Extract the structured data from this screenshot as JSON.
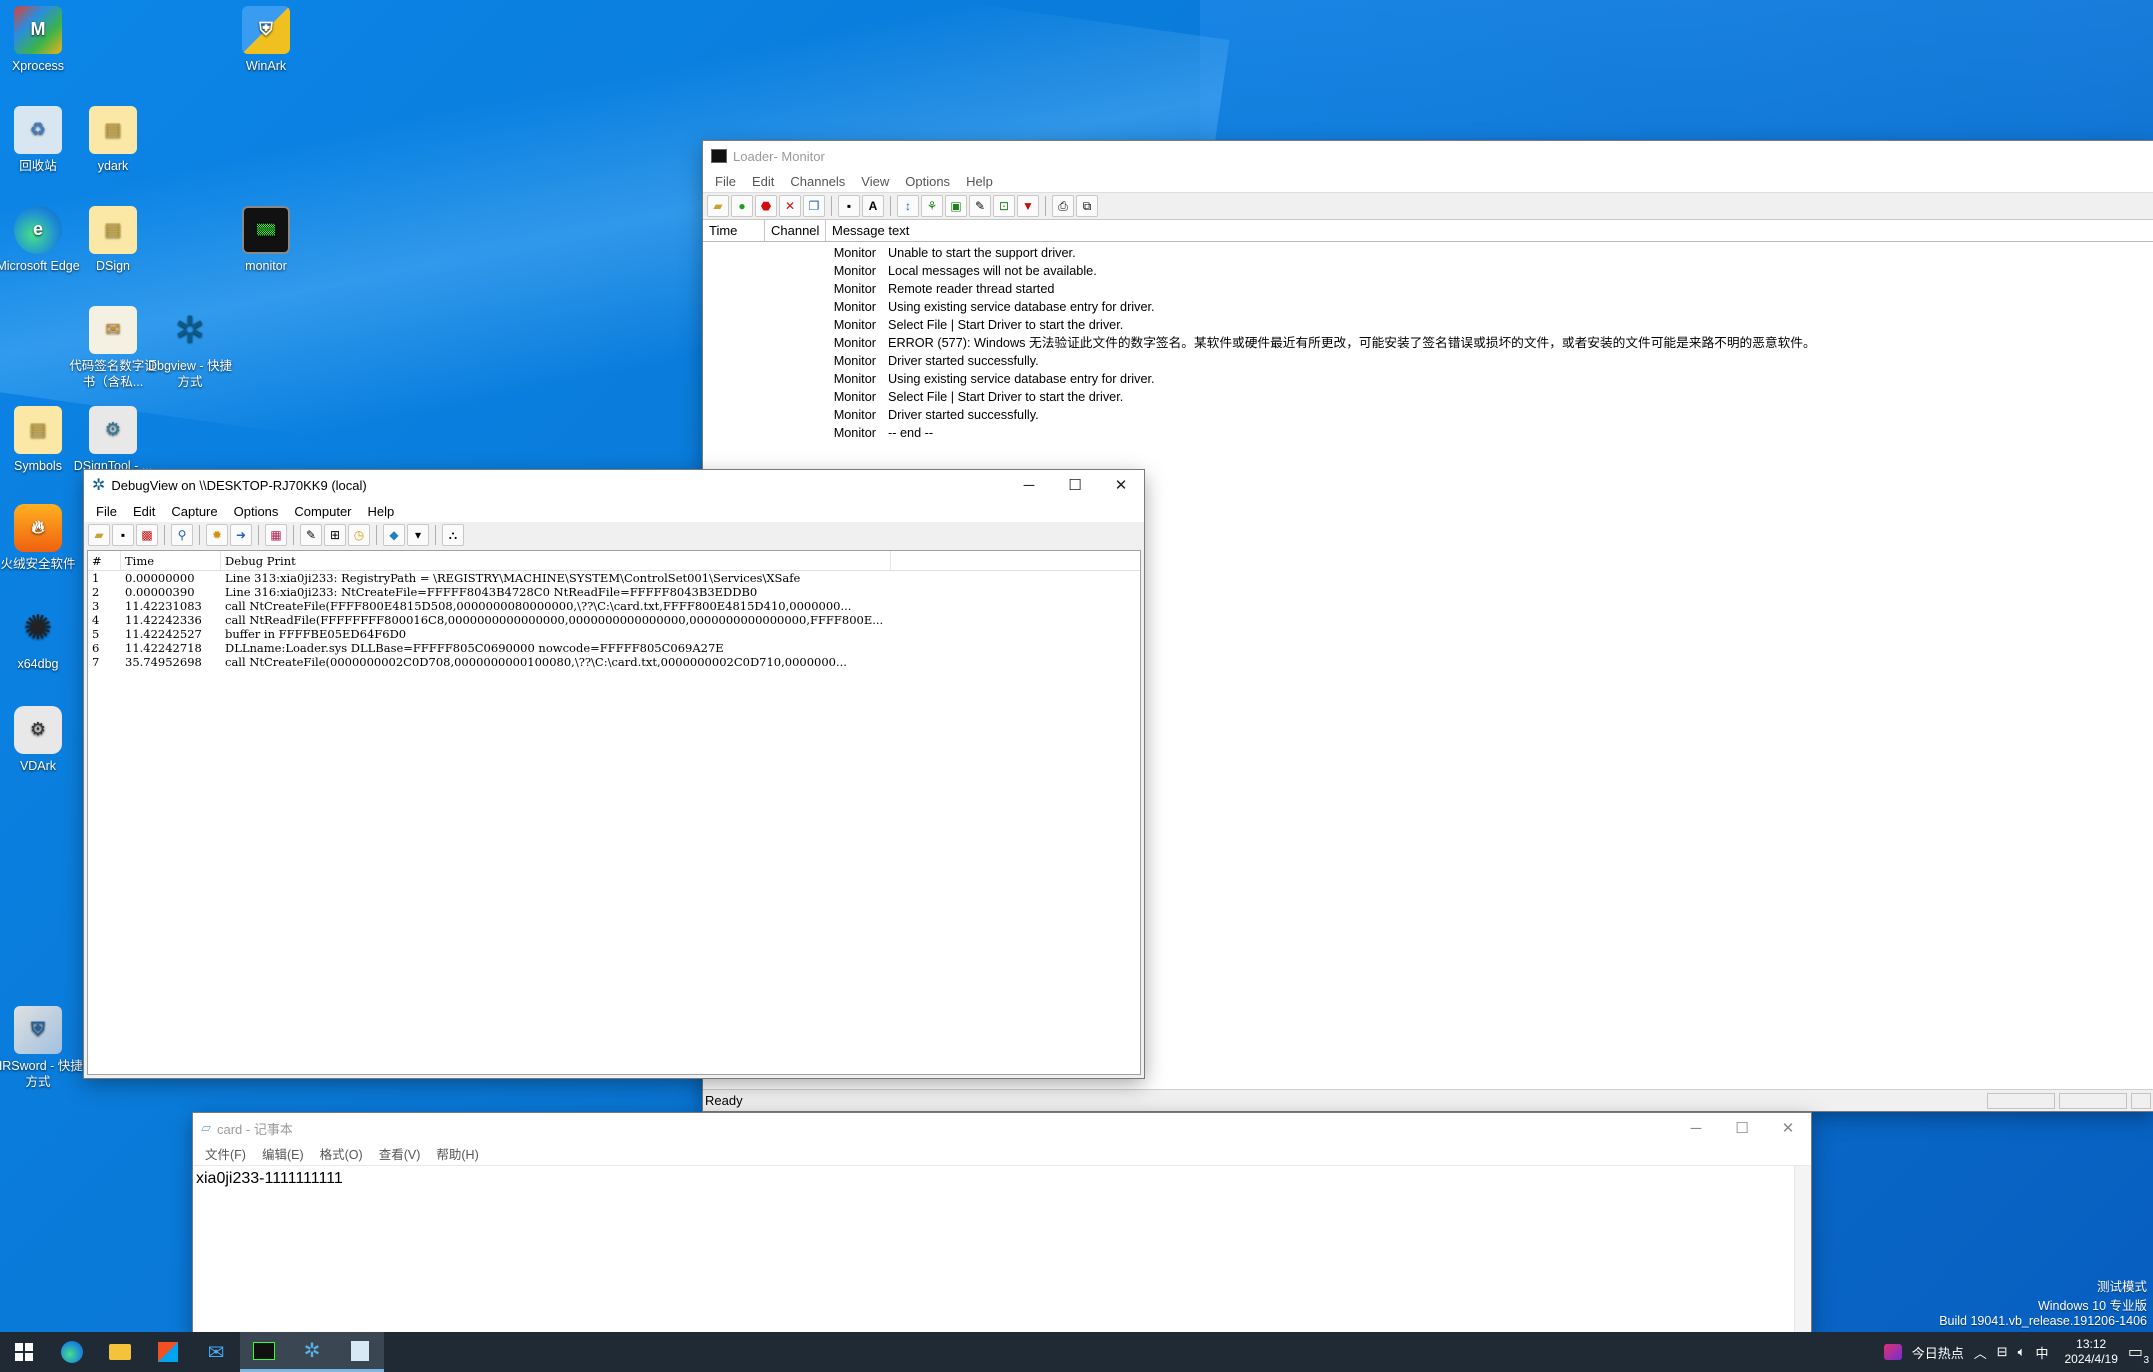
{
  "desktop": {
    "icons": [
      {
        "label": "Xprocess"
      },
      {
        "label": "WinArk"
      },
      {
        "label": "回收站"
      },
      {
        "label": "ydark"
      },
      {
        "label": "Microsoft Edge"
      },
      {
        "label": "DSign"
      },
      {
        "label": "monitor"
      },
      {
        "label": "代码签名数字证书（含私..."
      },
      {
        "label": "Dbgview - 快捷方式"
      },
      {
        "label": "Symbols"
      },
      {
        "label": "DSignTool - ..."
      },
      {
        "label": "火绒安全软件"
      },
      {
        "label": "x64dbg"
      },
      {
        "label": "VDArk"
      },
      {
        "label": "HRSword - 快捷方式"
      }
    ]
  },
  "monitor_window": {
    "title": "Loader- Monitor",
    "menu": [
      "File",
      "Edit",
      "Channels",
      "View",
      "Options",
      "Help"
    ],
    "columns": [
      "Time",
      "Channel",
      "Message text"
    ],
    "rows": [
      {
        "time": "",
        "channel": "Monitor",
        "text": "Unable to start the support driver."
      },
      {
        "time": "",
        "channel": "Monitor",
        "text": "Local messages will not be available."
      },
      {
        "time": "",
        "channel": "Monitor",
        "text": "Remote reader thread started"
      },
      {
        "time": "",
        "channel": "Monitor",
        "text": "Using existing service database entry for driver."
      },
      {
        "time": "",
        "channel": "Monitor",
        "text": "Select File | Start Driver to start the driver."
      },
      {
        "time": "",
        "channel": "Monitor",
        "text": "ERROR (577): Windows 无法验证此文件的数字签名。某软件或硬件最近有所更改，可能安装了签名错误或损坏的文件，或者安装的文件可能是来路不明的恶意软件。"
      },
      {
        "time": "",
        "channel": "Monitor",
        "text": "Driver started successfully."
      },
      {
        "time": "",
        "channel": "Monitor",
        "text": "Using existing service database entry for driver."
      },
      {
        "time": "",
        "channel": "Monitor",
        "text": "Select File | Start Driver to start the driver."
      },
      {
        "time": "",
        "channel": "Monitor",
        "text": "Driver started successfully."
      },
      {
        "time": "",
        "channel": "Monitor",
        "text": " -- end --"
      }
    ],
    "status": "Ready"
  },
  "debugview_window": {
    "title": "DebugView on \\\\DESKTOP-RJ70KK9 (local)",
    "menu": [
      "File",
      "Edit",
      "Capture",
      "Options",
      "Computer",
      "Help"
    ],
    "columns": [
      "#",
      "Time",
      "Debug Print"
    ],
    "rows": [
      {
        "n": "1",
        "time": "0.00000000",
        "text": "Line 313:xia0ji233: RegistryPath = \\REGISTRY\\MACHINE\\SYSTEM\\ControlSet001\\Services\\XSafe"
      },
      {
        "n": "2",
        "time": "0.00000390",
        "text": "Line 316:xia0ji233: NtCreateFile=FFFFF8043B4728C0 NtReadFile=FFFFF8043B3EDDB0"
      },
      {
        "n": "3",
        "time": "11.42231083",
        "text": "call NtCreateFile(FFFF800E4815D508,0000000080000000,\\??\\C:\\card.txt,FFFF800E4815D410,0000000..."
      },
      {
        "n": "4",
        "time": "11.42242336",
        "text": "call NtReadFile(FFFFFFFF800016C8,0000000000000000,0000000000000000,0000000000000000,FFFF800E..."
      },
      {
        "n": "5",
        "time": "11.42242527",
        "text": "buffer in FFFFBE05ED64F6D0"
      },
      {
        "n": "6",
        "time": "11.42242718",
        "text": "DLLname:Loader.sys DLLBase=FFFFF805C0690000 nowcode=FFFFF805C069A27E"
      },
      {
        "n": "7",
        "time": "35.74952698",
        "text": "call NtCreateFile(0000000002C0D708,0000000000100080,\\??\\C:\\card.txt,0000000002C0D710,0000000..."
      }
    ]
  },
  "notepad_window": {
    "title": "card - 记事本",
    "menu": [
      "文件(F)",
      "编辑(E)",
      "格式(O)",
      "查看(V)",
      "帮助(H)"
    ],
    "content": "xia0ji233-1111111111"
  },
  "watermark": {
    "line1": "测试模式",
    "line2": "Windows 10 专业版",
    "line3": "Build 19041.vb_release.191206-1406"
  },
  "taskbar": {
    "news": "今日热点",
    "ime": "中",
    "time": "13:12",
    "date": "2024/4/19",
    "notif_count": "3"
  }
}
